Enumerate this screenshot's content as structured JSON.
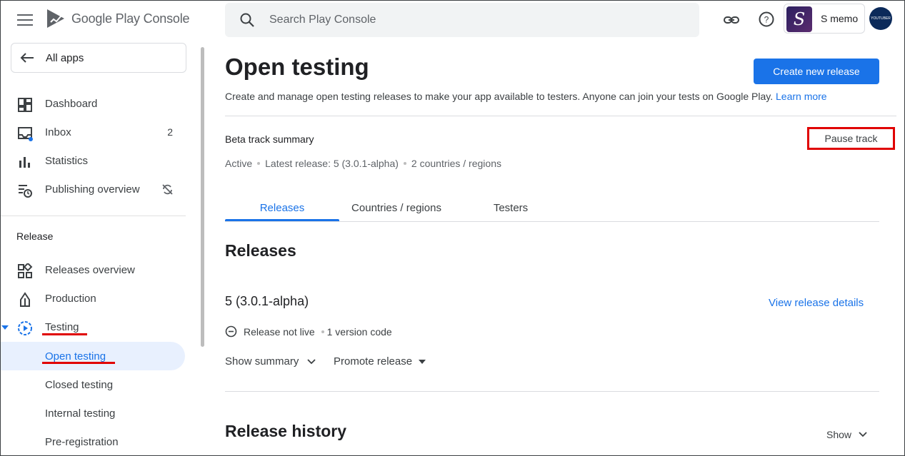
{
  "header": {
    "app_name": "Google Play Console",
    "search_placeholder": "Search Play Console",
    "account_name": "S memo",
    "app_avatar_letter": "S",
    "user_avatar_text": "YOUTUBER"
  },
  "sidebar": {
    "all_apps": "All apps",
    "items": [
      {
        "label": "Dashboard",
        "icon": "dashboard-icon"
      },
      {
        "label": "Inbox",
        "icon": "inbox-icon",
        "count": "2"
      },
      {
        "label": "Statistics",
        "icon": "statistics-icon"
      },
      {
        "label": "Publishing overview",
        "icon": "publishing-overview-icon"
      }
    ],
    "section": "Release",
    "release_items": [
      {
        "label": "Releases overview",
        "icon": "releases-overview-icon"
      },
      {
        "label": "Production",
        "icon": "production-icon"
      },
      {
        "label": "Testing",
        "icon": "testing-icon"
      }
    ],
    "testing_sub": [
      "Open testing",
      "Closed testing",
      "Internal testing",
      "Pre-registration"
    ]
  },
  "main": {
    "title": "Open testing",
    "create_button": "Create new release",
    "description": "Create and manage open testing releases to make your app available to testers. Anyone can join your tests on Google Play.",
    "learn_more": "Learn more",
    "summary_title": "Beta track summary",
    "pause_button": "Pause track",
    "status": "Active",
    "latest_release": "Latest release: 5 (3.0.1-alpha)",
    "countries": "2 countries / regions",
    "tabs": [
      "Releases",
      "Countries / regions",
      "Testers"
    ],
    "releases_heading": "Releases",
    "release_name": "5 (3.0.1-alpha)",
    "view_details": "View release details",
    "release_status": "Release not live",
    "version_code": "1 version code",
    "show_summary": "Show summary",
    "promote_release": "Promote release",
    "history_heading": "Release history",
    "show": "Show"
  },
  "colors": {
    "accent": "#1a73e8",
    "highlight_red": "#e00000",
    "active_nav_bg": "#e8f0fe"
  }
}
